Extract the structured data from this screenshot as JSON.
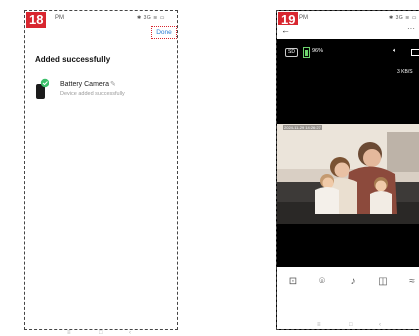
{
  "screen1": {
    "step": "18",
    "status_time": "PM",
    "status_right": "✱ 3G ≋ ▭",
    "done_label": "Done",
    "title": "Added successfully",
    "device": {
      "name": "Battery Camera",
      "status": "Device added successfully",
      "icon": "camera-device-icon",
      "edit_icon": "pencil-icon"
    },
    "nav": {
      "menu": "≡",
      "home": "□",
      "back": "‹"
    }
  },
  "screen2": {
    "step": "19",
    "status_time": "PM",
    "status_right": "✱ 3G ≋ ▭",
    "header": {
      "back": "←",
      "more": "···"
    },
    "sd_label": "SD",
    "battery_pct": "96%",
    "data_rate": "3 KB/S",
    "timestamp": "2024-11-29 14:26:27",
    "toolbar": {
      "icons": [
        "screenshot-icon",
        "camera-icon",
        "microphone-icon",
        "record-icon",
        "more-icon"
      ],
      "glyphs": [
        "⊡",
        "⌾",
        "♪",
        "◫",
        "≈"
      ]
    },
    "nav": {
      "menu": "≡",
      "home": "□",
      "back": "‹"
    }
  },
  "colors": {
    "accent": "#d8262f",
    "link": "#2b7cd3",
    "battery": "#6dd46d"
  }
}
